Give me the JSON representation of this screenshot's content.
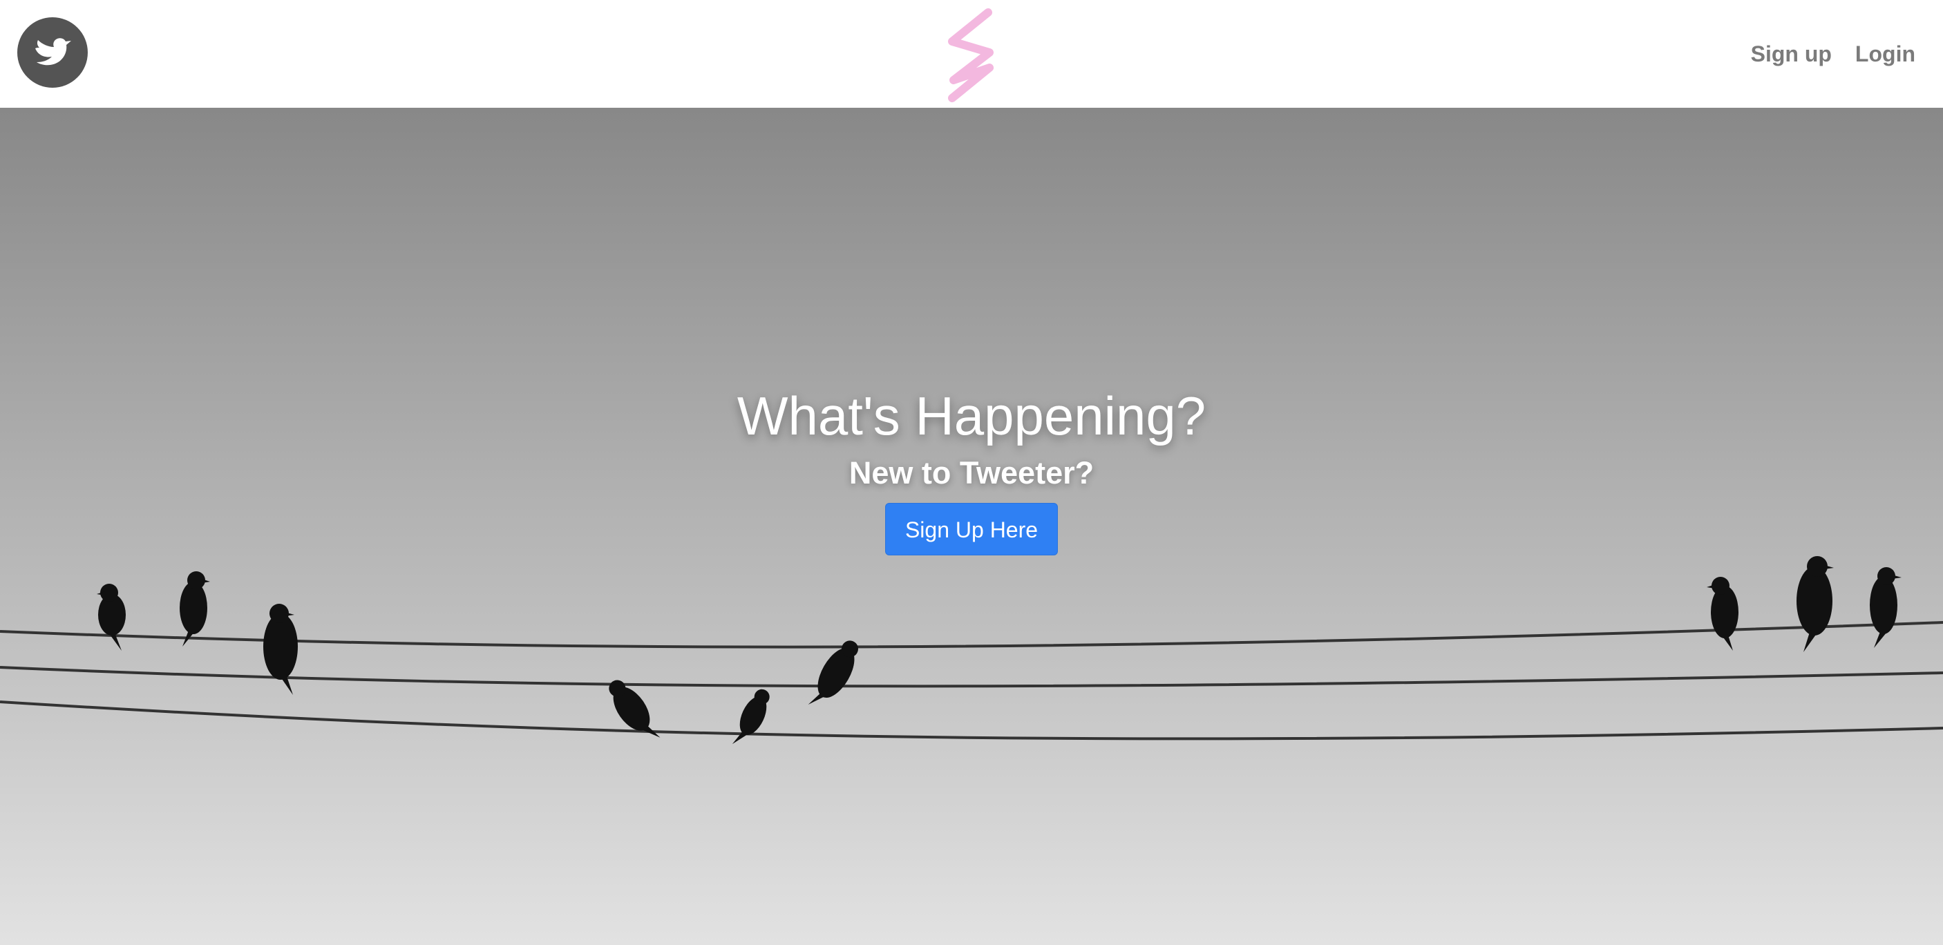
{
  "header": {
    "brand_icon": "bird-icon",
    "center_logo_icon": "zigzag-logo-icon",
    "nav": {
      "signup_label": "Sign up",
      "login_label": "Login"
    }
  },
  "hero": {
    "headline": "What's Happening?",
    "subheading": "New to Tweeter?",
    "cta_label": "Sign Up Here",
    "background_image": "birds-on-power-lines"
  },
  "colors": {
    "brand_circle": "#545454",
    "center_logo": "#f3b8df",
    "nav_link": "#7b7b7b",
    "cta_button": "#2f80f3",
    "hero_text": "#ffffff"
  }
}
